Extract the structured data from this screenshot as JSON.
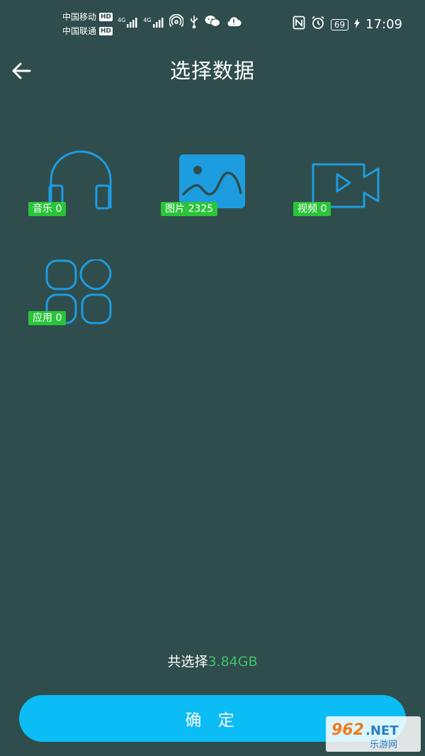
{
  "status_bar": {
    "carrier_1": "中国移动",
    "carrier_2": "中国联通",
    "hd_badge": "HD",
    "network_1": "4G",
    "network_2": "4G",
    "battery_level": "69",
    "time": "17:09"
  },
  "header": {
    "title": "选择数据",
    "back_icon": "arrow-left-icon"
  },
  "categories": [
    {
      "label": "音乐",
      "count": " 0",
      "icon": "headphones-icon"
    },
    {
      "label": "图片",
      "count": " 2325",
      "icon": "image-icon"
    },
    {
      "label": "视频",
      "count": " 0",
      "icon": "video-camera-icon"
    },
    {
      "label": "应用",
      "count": " 0",
      "icon": "apps-grid-icon"
    }
  ],
  "footer": {
    "total_prefix": "共选择",
    "total_size": "3.84GB",
    "confirm_label": "确 定"
  },
  "watermark": {
    "logo_text": "962.NET",
    "sub_text": "乐游网"
  },
  "colors": {
    "background": "#2f4d4c",
    "icon_stroke": "#1e9ce0",
    "badge": "#2bc43a",
    "accent_button": "#0bbcf5",
    "size_text": "#3fc06c"
  }
}
